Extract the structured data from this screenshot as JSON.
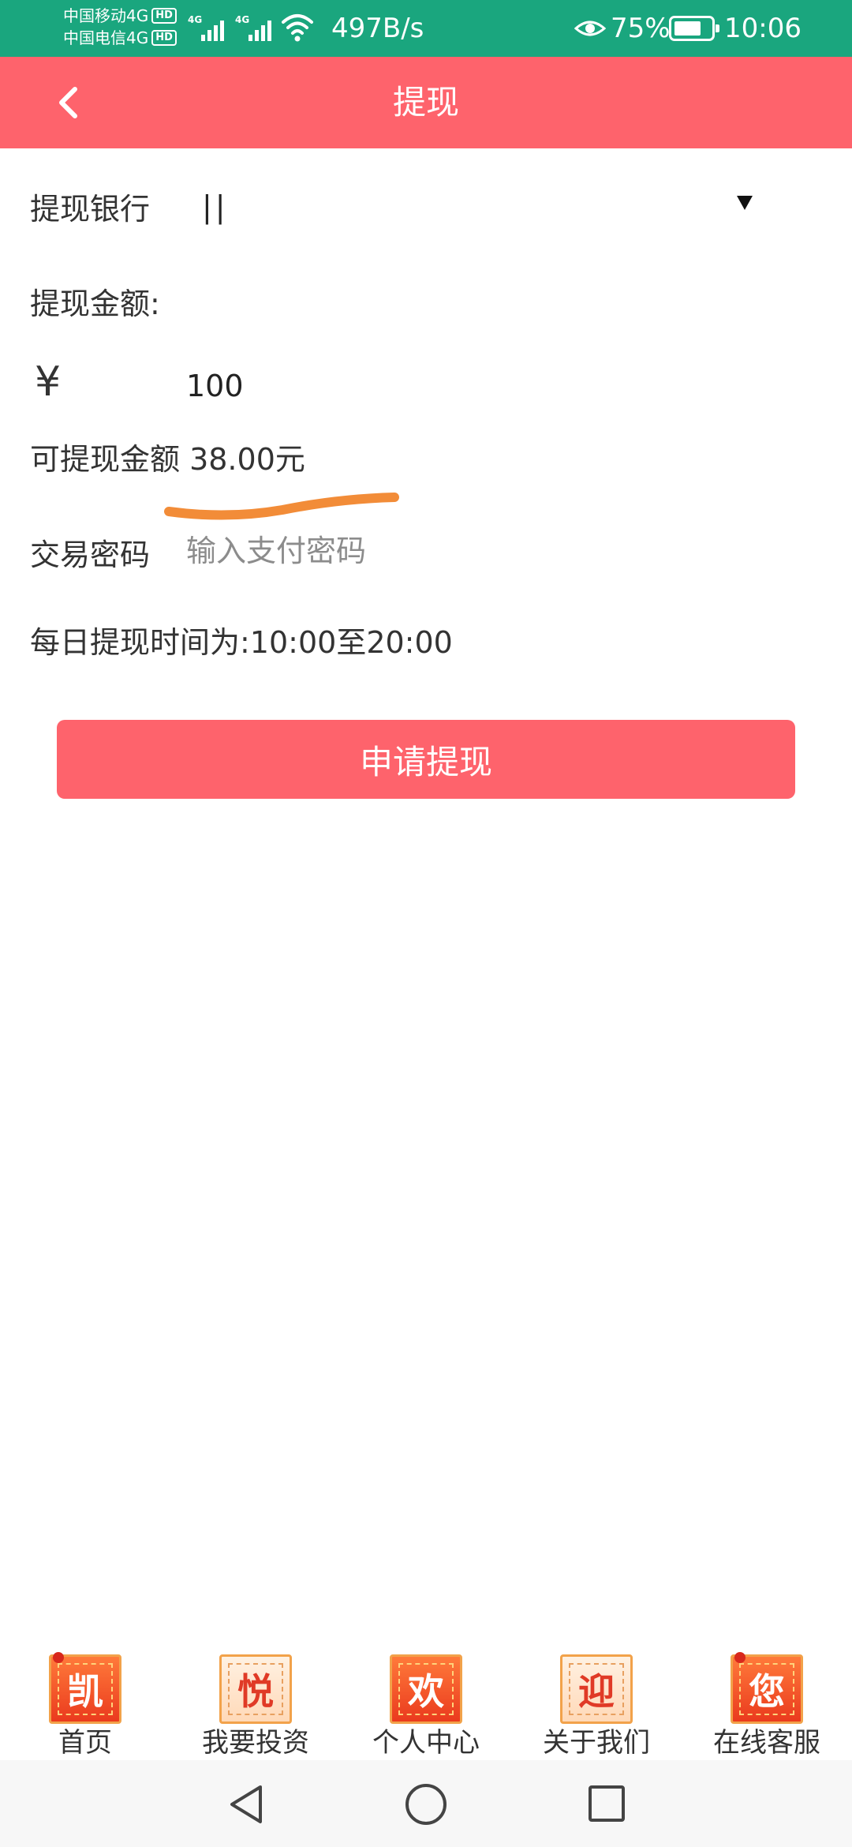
{
  "status_bar": {
    "carrier_1": "中国移动4G",
    "carrier_2": "中国电信4G",
    "hd_badge": "HD",
    "signal_tag": "4G",
    "net_speed": "497B/s",
    "battery_percent": "75%",
    "battery_level": 0.75,
    "time": "10:06"
  },
  "header": {
    "title": "提现",
    "back_icon": "chevron-left-icon"
  },
  "form": {
    "bank_label": "提现银行",
    "bank_value": "||",
    "amount_label": "提现金额:",
    "currency_symbol": "¥",
    "amount_value": "100",
    "available_text": "可提现金额 38.00元",
    "password_label": "交易密码",
    "password_placeholder": "输入支付密码",
    "hours_text": "每日提现时间为:10:00至20:00",
    "submit_label": "申请提现"
  },
  "tab_bar": {
    "items": [
      {
        "label": "首页",
        "icon_char": "凯"
      },
      {
        "label": "我要投资",
        "icon_char": "悦"
      },
      {
        "label": "个人中心",
        "icon_char": "欢"
      },
      {
        "label": "关于我们",
        "icon_char": "迎"
      },
      {
        "label": "在线客服",
        "icon_char": "您"
      }
    ]
  },
  "colors": {
    "status_bar": "#1aa67e",
    "accent": "#fe636c",
    "annotation_underline": "#f28c38"
  }
}
